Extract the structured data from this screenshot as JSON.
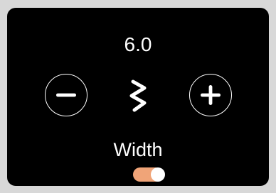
{
  "width_setting": {
    "value": "6.0",
    "label": "Width",
    "decrease_icon": "minus-icon",
    "increase_icon": "plus-icon",
    "stitch_icon": "zigzag-stitch-icon",
    "toggle_on": true
  },
  "colors": {
    "panel_background": "#000000",
    "foreground": "#ffffff",
    "toggle_accent": "#f0a478"
  }
}
